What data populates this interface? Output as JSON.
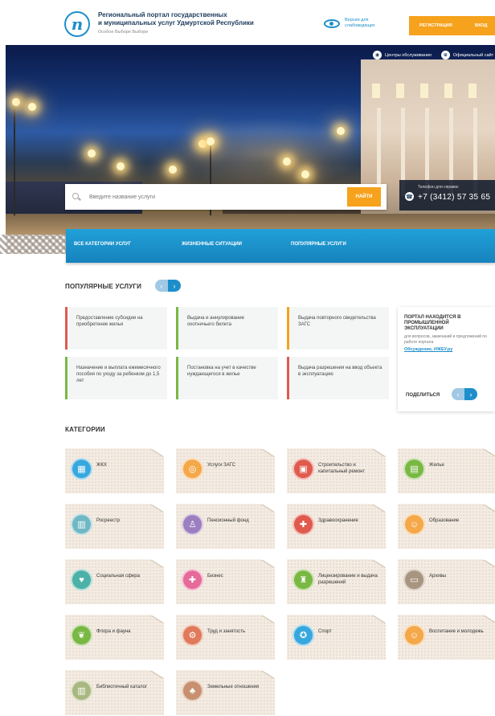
{
  "header": {
    "title_line1": "Региональный портал государственных",
    "title_line2": "и муниципальных услуг Удмуртской Республики",
    "subtitle": "Особое Выборе Выборе",
    "accessibility_label": "Версия для слабовидящих",
    "register_label": "Регистрация",
    "login_label": "Вход"
  },
  "hero": {
    "topbar": {
      "service_centers_label": "Центры обслуживания",
      "official_portal_label": "Официальный сайт"
    },
    "search": {
      "placeholder": "Введите название услуги",
      "button_label": "Найти"
    },
    "phone": {
      "label": "Телефон для справок",
      "number": "+7 (3412) 57 35 65"
    }
  },
  "nav": {
    "items": [
      {
        "label": "Все категории услуг"
      },
      {
        "label": "Жизненные ситуации"
      },
      {
        "label": "Популярные услуги"
      }
    ]
  },
  "popular": {
    "title": "Популярные услуги",
    "pager_prev": "‹",
    "pager_next": "›",
    "services": [
      {
        "text": "Предоставление субсидии на приобретение жилья",
        "color": "#e05a4e"
      },
      {
        "text": "Выдача и аннулирование охотничьего билета",
        "color": "#7ab844"
      },
      {
        "text": "Выдача повторного свидетельства ЗАГС",
        "color": "#f6a21c"
      },
      {
        "text": "Назначение и выплата ежемесячного пособия по уходу за ребенком до 1,5 лет",
        "color": "#7ab844"
      },
      {
        "text": "Постановка на учет в качестве нуждающегося в жилье",
        "color": "#7ab844"
      },
      {
        "text": "Выдача разрешения на ввод объекта в эксплуатацию",
        "color": "#e05a4e"
      }
    ],
    "promo": {
      "heading": "Портал находится в промышленной эксплуатации",
      "body": "для вопросов, замечаний и предложений по работе портала",
      "link": "Обсуждение, ИЖЕУ.ру",
      "share_label": "Поделиться",
      "pager_prev": "‹",
      "pager_next": "›"
    }
  },
  "categories": {
    "title": "Категории",
    "items": [
      {
        "label": "ЖКХ",
        "icon": "building-icon",
        "glyph": "▦",
        "color": "#37a8de"
      },
      {
        "label": "Услуги ЗАГС",
        "icon": "rings-icon",
        "glyph": "◎",
        "color": "#f4a84a"
      },
      {
        "label": "Строительство и капитальный ремонт",
        "icon": "construction-icon",
        "glyph": "▣",
        "color": "#e05a4e"
      },
      {
        "label": "Жилье",
        "icon": "house-icon",
        "glyph": "▤",
        "color": "#7ab844"
      },
      {
        "label": "Росреестр",
        "icon": "map-book-icon",
        "glyph": "▥",
        "color": "#6fb8c4"
      },
      {
        "label": "Пенсионный фонд",
        "icon": "person-icon",
        "glyph": "♙",
        "color": "#9b7fbf"
      },
      {
        "label": "Здравоохранение",
        "icon": "medical-cross-icon",
        "glyph": "✚",
        "color": "#e05a4e"
      },
      {
        "label": "Образование",
        "icon": "children-icon",
        "glyph": "☺",
        "color": "#f4a84a"
      },
      {
        "label": "Социальная сфера",
        "icon": "heart-hands-icon",
        "glyph": "♥",
        "color": "#4cb2a8"
      },
      {
        "label": "Бизнес",
        "icon": "briefcase-icon",
        "glyph": "✚",
        "color": "#e66a9a"
      },
      {
        "label": "Лицензирование и выдача разрешений",
        "icon": "license-icon",
        "glyph": "♜",
        "color": "#7ab844"
      },
      {
        "label": "Архивы",
        "icon": "archive-icon",
        "glyph": "▭",
        "color": "#a89580"
      },
      {
        "label": "Флора и фауна",
        "icon": "leaf-icon",
        "glyph": "❦",
        "color": "#7ab844"
      },
      {
        "label": "Труд и занятость",
        "icon": "gears-icon",
        "glyph": "⚙",
        "color": "#e07a5a"
      },
      {
        "label": "Спорт",
        "icon": "ball-icon",
        "glyph": "✪",
        "color": "#37a8de"
      },
      {
        "label": "Воспитание и молодежь",
        "icon": "family-icon",
        "glyph": "☺",
        "color": "#f4a84a"
      },
      {
        "label": "Библиотечный каталог",
        "icon": "books-icon",
        "glyph": "▥",
        "color": "#a8b880"
      },
      {
        "label": "Земельные отношения",
        "icon": "land-icon",
        "glyph": "♣",
        "color": "#c89070"
      }
    ]
  }
}
